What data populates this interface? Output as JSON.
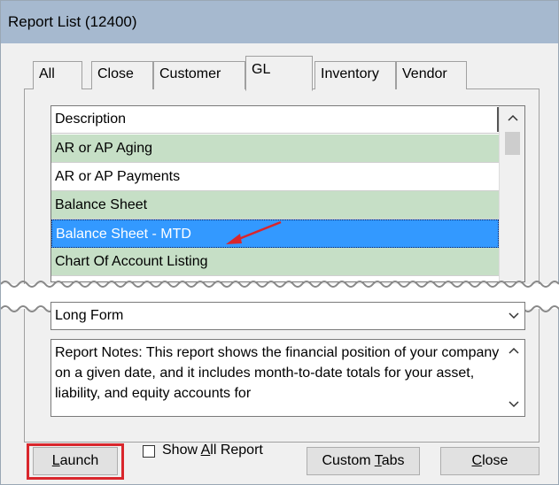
{
  "window": {
    "title": "Report List (12400)"
  },
  "tabs": [
    {
      "label": "All"
    },
    {
      "label": "Close"
    },
    {
      "label": "Customer"
    },
    {
      "label": "GL"
    },
    {
      "label": "Inventory"
    },
    {
      "label": "Vendor"
    }
  ],
  "active_tab": "GL",
  "list": {
    "column_header": "Description",
    "rows": [
      {
        "label": "AR or AP Aging",
        "style": "green"
      },
      {
        "label": "AR or AP Payments",
        "style": "white"
      },
      {
        "label": "Balance Sheet",
        "style": "green"
      },
      {
        "label": "Balance Sheet - MTD",
        "style": "selected"
      },
      {
        "label": "Chart Of Account Listing",
        "style": "green"
      }
    ]
  },
  "format_dropdown": {
    "value": "Long Form"
  },
  "notes": {
    "text": "Report Notes:  This report shows the financial position of your company on a given date, and it includes month-to-date totals for your asset, liability, and equity accounts for"
  },
  "buttons": {
    "launch": {
      "pre": "",
      "accel": "L",
      "post": "aunch"
    },
    "custom_tabs": {
      "pre": "Custom ",
      "accel": "T",
      "post": "abs"
    },
    "close": {
      "pre": "",
      "accel": "C",
      "post": "lose"
    }
  },
  "show_all": {
    "pre": "Show ",
    "accel": "A",
    "post": "ll Report",
    "checked": false
  },
  "colors": {
    "titlebar": "#a6b9cf",
    "row_green": "#c6dfc6",
    "selected": "#3399ff",
    "annotation_red": "#d9262c"
  }
}
